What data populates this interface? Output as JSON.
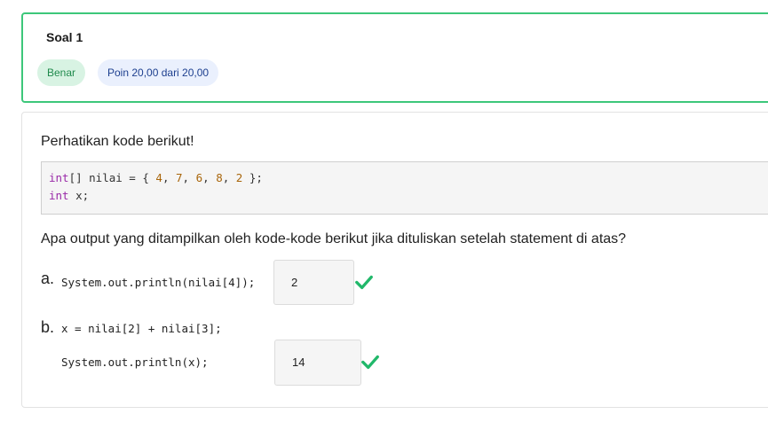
{
  "header": {
    "title": "Soal 1",
    "status_badge": "Benar",
    "score_badge": "Poin 20,00 dari 20,00"
  },
  "question": {
    "intro": "Perhatikan kode berikut!",
    "code_lines": [
      [
        {
          "t": "int",
          "c": "type"
        },
        {
          "t": "[] nilai = { "
        },
        {
          "t": "4",
          "c": "num"
        },
        {
          "t": ", "
        },
        {
          "t": "7",
          "c": "num"
        },
        {
          "t": ", "
        },
        {
          "t": "6",
          "c": "num"
        },
        {
          "t": ", "
        },
        {
          "t": "8",
          "c": "num"
        },
        {
          "t": ", "
        },
        {
          "t": "2",
          "c": "num"
        },
        {
          "t": " };"
        }
      ],
      [
        {
          "t": "int",
          "c": "type"
        },
        {
          "t": " x;"
        }
      ]
    ],
    "prompt": "Apa output yang ditampilkan oleh kode-kode berikut jika dituliskan setelah statement di atas?",
    "parts": {
      "a": {
        "label": "a.",
        "code": "System.out.println(nilai[4]);",
        "answer": "2"
      },
      "b": {
        "label": "b.",
        "code1": "x = nilai[2] + nilai[3];",
        "code2": "System.out.println(x);",
        "answer": "14"
      }
    }
  },
  "colors": {
    "correct": "#21b86a",
    "card_border": "#3cc77a"
  },
  "icons": {
    "correct": "check-icon"
  }
}
